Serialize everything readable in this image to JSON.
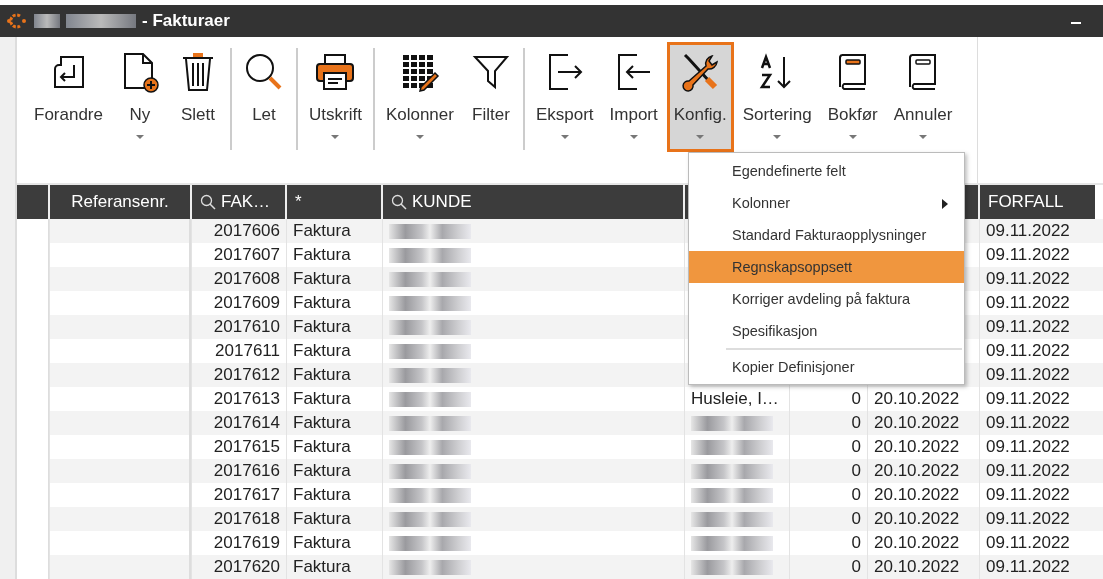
{
  "window": {
    "title": "- Fakturaer"
  },
  "toolbar": {
    "groups": [
      [
        {
          "label": "Forandre",
          "has_menu": false,
          "selected": false
        },
        {
          "label": "Ny",
          "has_menu": true,
          "selected": false
        },
        {
          "label": "Slett",
          "has_menu": false,
          "selected": false
        }
      ],
      [
        {
          "label": "Let",
          "has_menu": false,
          "selected": false
        }
      ],
      [
        {
          "label": "Utskrift",
          "has_menu": true,
          "selected": false
        }
      ],
      [
        {
          "label": "Kolonner",
          "has_menu": true,
          "selected": false
        },
        {
          "label": "Filter",
          "has_menu": false,
          "selected": false
        }
      ],
      [
        {
          "label": "Eksport",
          "has_menu": true,
          "selected": false
        },
        {
          "label": "Import",
          "has_menu": true,
          "selected": false
        },
        {
          "label": "Konfig.",
          "has_menu": true,
          "selected": true
        },
        {
          "label": "Sortering",
          "has_menu": true,
          "selected": false
        },
        {
          "label": "Bokfør",
          "has_menu": true,
          "selected": false
        },
        {
          "label": "Annuler",
          "has_menu": true,
          "selected": false
        }
      ]
    ]
  },
  "menu": {
    "items": [
      {
        "kind": "item",
        "label": "Egendefinerte felt",
        "submenu": false,
        "selected": false
      },
      {
        "kind": "item",
        "label": "Kolonner",
        "submenu": true,
        "selected": false
      },
      {
        "kind": "item",
        "label": "Standard Fakturaopplysninger",
        "submenu": false,
        "selected": false
      },
      {
        "kind": "item",
        "label": "Regnskapsoppsett",
        "submenu": false,
        "selected": true
      },
      {
        "kind": "item",
        "label": "Korriger avdeling på faktura",
        "submenu": false,
        "selected": false
      },
      {
        "kind": "item",
        "label": "Spesifikasjon",
        "submenu": false,
        "selected": false
      },
      {
        "kind": "separator"
      },
      {
        "kind": "item",
        "label": "Kopier Definisjoner",
        "submenu": false,
        "selected": false
      }
    ]
  },
  "table": {
    "columns": [
      {
        "label": "Referansenr.",
        "search": false
      },
      {
        "label": "FAK…",
        "search": true
      },
      {
        "label": "*",
        "search": false
      },
      {
        "label": "KUNDE",
        "search": true
      },
      {},
      {},
      {},
      {
        "label": "FORFALL",
        "search": false
      }
    ],
    "rows": [
      {
        "cells": [
          {
            "kind": "text",
            "text": ""
          },
          {
            "kind": "text",
            "text": "2017606"
          },
          {
            "kind": "text",
            "text": "Faktura"
          },
          {
            "kind": "redacted"
          },
          {
            "kind": "hidden"
          },
          {
            "kind": "hidden"
          },
          {
            "kind": "hidden"
          },
          {
            "kind": "text",
            "text": "09.11.2022"
          }
        ]
      },
      {
        "cells": [
          {
            "kind": "text",
            "text": ""
          },
          {
            "kind": "text",
            "text": "2017607"
          },
          {
            "kind": "text",
            "text": "Faktura"
          },
          {
            "kind": "redacted"
          },
          {
            "kind": "hidden"
          },
          {
            "kind": "hidden"
          },
          {
            "kind": "hidden"
          },
          {
            "kind": "text",
            "text": "09.11.2022"
          }
        ]
      },
      {
        "cells": [
          {
            "kind": "text",
            "text": ""
          },
          {
            "kind": "text",
            "text": "2017608"
          },
          {
            "kind": "text",
            "text": "Faktura"
          },
          {
            "kind": "redacted"
          },
          {
            "kind": "hidden"
          },
          {
            "kind": "hidden"
          },
          {
            "kind": "hidden"
          },
          {
            "kind": "text",
            "text": "09.11.2022"
          }
        ]
      },
      {
        "cells": [
          {
            "kind": "text",
            "text": ""
          },
          {
            "kind": "text",
            "text": "2017609"
          },
          {
            "kind": "text",
            "text": "Faktura"
          },
          {
            "kind": "redacted"
          },
          {
            "kind": "hidden"
          },
          {
            "kind": "hidden"
          },
          {
            "kind": "hidden"
          },
          {
            "kind": "text",
            "text": "09.11.2022"
          }
        ]
      },
      {
        "cells": [
          {
            "kind": "text",
            "text": ""
          },
          {
            "kind": "text",
            "text": "2017610"
          },
          {
            "kind": "text",
            "text": "Faktura"
          },
          {
            "kind": "redacted"
          },
          {
            "kind": "hidden"
          },
          {
            "kind": "hidden"
          },
          {
            "kind": "hidden"
          },
          {
            "kind": "text",
            "text": "09.11.2022"
          }
        ]
      },
      {
        "cells": [
          {
            "kind": "text",
            "text": ""
          },
          {
            "kind": "text",
            "text": "2017611"
          },
          {
            "kind": "text",
            "text": "Faktura"
          },
          {
            "kind": "redacted"
          },
          {
            "kind": "hidden"
          },
          {
            "kind": "hidden"
          },
          {
            "kind": "hidden"
          },
          {
            "kind": "text",
            "text": "09.11.2022"
          }
        ]
      },
      {
        "cells": [
          {
            "kind": "text",
            "text": ""
          },
          {
            "kind": "text",
            "text": "2017612"
          },
          {
            "kind": "text",
            "text": "Faktura"
          },
          {
            "kind": "redacted"
          },
          {
            "kind": "hidden"
          },
          {
            "kind": "hidden"
          },
          {
            "kind": "hidden"
          },
          {
            "kind": "text",
            "text": "09.11.2022"
          }
        ]
      },
      {
        "cells": [
          {
            "kind": "text",
            "text": ""
          },
          {
            "kind": "text",
            "text": "2017613"
          },
          {
            "kind": "text",
            "text": "Faktura"
          },
          {
            "kind": "redacted"
          },
          {
            "kind": "text",
            "text": "Husleie, I…"
          },
          {
            "kind": "text",
            "text": "0"
          },
          {
            "kind": "text",
            "text": "20.10.2022"
          },
          {
            "kind": "text",
            "text": "09.11.2022"
          }
        ]
      },
      {
        "cells": [
          {
            "kind": "text",
            "text": ""
          },
          {
            "kind": "text",
            "text": "2017614"
          },
          {
            "kind": "text",
            "text": "Faktura"
          },
          {
            "kind": "redacted"
          },
          {
            "kind": "redacted"
          },
          {
            "kind": "text",
            "text": "0"
          },
          {
            "kind": "text",
            "text": "20.10.2022"
          },
          {
            "kind": "text",
            "text": "09.11.2022"
          }
        ]
      },
      {
        "cells": [
          {
            "kind": "text",
            "text": ""
          },
          {
            "kind": "text",
            "text": "2017615"
          },
          {
            "kind": "text",
            "text": "Faktura"
          },
          {
            "kind": "redacted"
          },
          {
            "kind": "redacted"
          },
          {
            "kind": "text",
            "text": "0"
          },
          {
            "kind": "text",
            "text": "20.10.2022"
          },
          {
            "kind": "text",
            "text": "09.11.2022"
          }
        ]
      },
      {
        "cells": [
          {
            "kind": "text",
            "text": ""
          },
          {
            "kind": "text",
            "text": "2017616"
          },
          {
            "kind": "text",
            "text": "Faktura"
          },
          {
            "kind": "redacted"
          },
          {
            "kind": "redacted"
          },
          {
            "kind": "text",
            "text": "0"
          },
          {
            "kind": "text",
            "text": "20.10.2022"
          },
          {
            "kind": "text",
            "text": "09.11.2022"
          }
        ]
      },
      {
        "cells": [
          {
            "kind": "text",
            "text": ""
          },
          {
            "kind": "text",
            "text": "2017617"
          },
          {
            "kind": "text",
            "text": "Faktura"
          },
          {
            "kind": "redacted"
          },
          {
            "kind": "redacted"
          },
          {
            "kind": "text",
            "text": "0"
          },
          {
            "kind": "text",
            "text": "20.10.2022"
          },
          {
            "kind": "text",
            "text": "09.11.2022"
          }
        ]
      },
      {
        "cells": [
          {
            "kind": "text",
            "text": ""
          },
          {
            "kind": "text",
            "text": "2017618"
          },
          {
            "kind": "text",
            "text": "Faktura"
          },
          {
            "kind": "redacted"
          },
          {
            "kind": "redacted"
          },
          {
            "kind": "text",
            "text": "0"
          },
          {
            "kind": "text",
            "text": "20.10.2022"
          },
          {
            "kind": "text",
            "text": "09.11.2022"
          }
        ]
      },
      {
        "cells": [
          {
            "kind": "text",
            "text": ""
          },
          {
            "kind": "text",
            "text": "2017619"
          },
          {
            "kind": "text",
            "text": "Faktura"
          },
          {
            "kind": "redacted"
          },
          {
            "kind": "redacted"
          },
          {
            "kind": "text",
            "text": "0"
          },
          {
            "kind": "text",
            "text": "20.10.2022"
          },
          {
            "kind": "text",
            "text": "09.11.2022"
          }
        ]
      },
      {
        "cells": [
          {
            "kind": "text",
            "text": ""
          },
          {
            "kind": "text",
            "text": "2017620"
          },
          {
            "kind": "text",
            "text": "Faktura"
          },
          {
            "kind": "redacted"
          },
          {
            "kind": "redacted"
          },
          {
            "kind": "text",
            "text": "0"
          },
          {
            "kind": "text",
            "text": "20.10.2022"
          },
          {
            "kind": "text",
            "text": "09.11.2022"
          }
        ]
      }
    ]
  }
}
